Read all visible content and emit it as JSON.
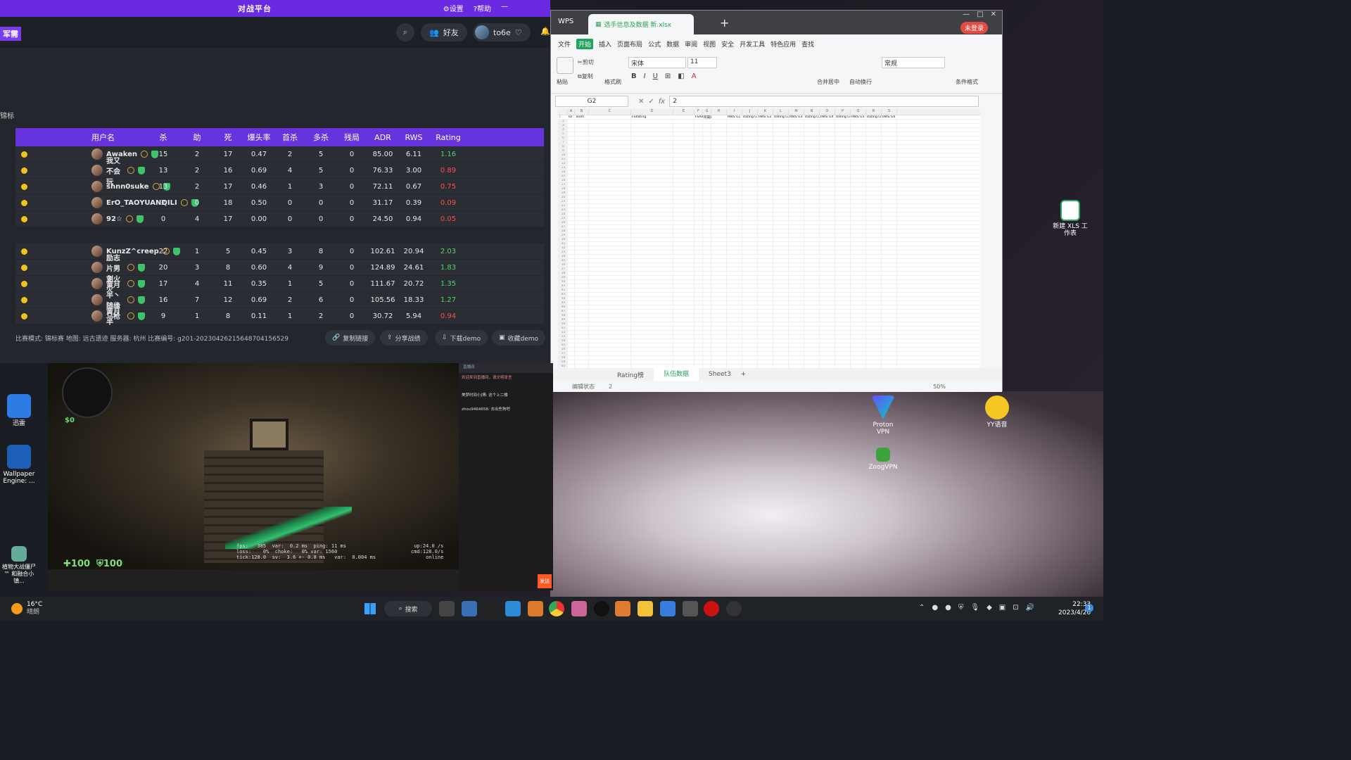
{
  "client": {
    "brand": "对战平台",
    "settings": "设置",
    "help": "帮助",
    "mode_tag": "军需",
    "friends": "好友",
    "username": "to6e",
    "left_label": "锦标"
  },
  "scoreboard": {
    "headers": [
      "用户名",
      "杀",
      "助",
      "死",
      "爆头率",
      "首杀",
      "多杀",
      "残局",
      "ADR",
      "RWS",
      "Rating"
    ],
    "team1": [
      {
        "name": "Awaken",
        "k": "15",
        "a": "2",
        "d": "17",
        "hs": "0.47",
        "fk": "2",
        "mk": "5",
        "cl": "0",
        "adr": "85.00",
        "rws": "6.11",
        "rating": "1.16"
      },
      {
        "name": "我又不会玩",
        "k": "13",
        "a": "2",
        "d": "16",
        "hs": "0.69",
        "fk": "4",
        "mk": "5",
        "cl": "0",
        "adr": "76.33",
        "rws": "3.00",
        "rating": "0.89"
      },
      {
        "name": "shnn0suke",
        "k": "13",
        "a": "2",
        "d": "17",
        "hs": "0.46",
        "fk": "1",
        "mk": "3",
        "cl": "0",
        "adr": "72.11",
        "rws": "0.67",
        "rating": "0.75"
      },
      {
        "name": "ErO_TAOYUANQILI",
        "k": "2",
        "a": "0",
        "d": "18",
        "hs": "0.50",
        "fk": "0",
        "mk": "0",
        "cl": "0",
        "adr": "31.17",
        "rws": "0.39",
        "rating": "0.09"
      },
      {
        "name": "92☆",
        "k": "0",
        "a": "4",
        "d": "17",
        "hs": "0.00",
        "fk": "0",
        "mk": "0",
        "cl": "0",
        "adr": "24.50",
        "rws": "0.94",
        "rating": "0.05"
      }
    ],
    "team2": [
      {
        "name": "KunzZ^creep",
        "k": "22",
        "a": "1",
        "d": "5",
        "hs": "0.45",
        "fk": "3",
        "mk": "8",
        "cl": "0",
        "adr": "102.61",
        "rws": "20.94",
        "rating": "2.03"
      },
      {
        "name": "励志片男主",
        "k": "20",
        "a": "3",
        "d": "8",
        "hs": "0.60",
        "fk": "4",
        "mk": "9",
        "cl": "0",
        "adr": "124.89",
        "rws": "24.61",
        "rating": "1.83"
      },
      {
        "name": "刘火火",
        "k": "17",
        "a": "4",
        "d": "11",
        "hs": "0.35",
        "fk": "1",
        "mk": "5",
        "cl": "0",
        "adr": "111.67",
        "rws": "20.72",
        "rating": "1.35"
      },
      {
        "name": "黄月半丶随缘马枪",
        "k": "16",
        "a": "7",
        "d": "12",
        "hs": "0.69",
        "fk": "2",
        "mk": "6",
        "cl": "0",
        "adr": "105.56",
        "rws": "18.33",
        "rating": "1.27"
      },
      {
        "name": "黄月半",
        "k": "9",
        "a": "1",
        "d": "8",
        "hs": "0.11",
        "fk": "1",
        "mk": "2",
        "cl": "0",
        "adr": "30.72",
        "rws": "5.94",
        "rating": "0.94"
      }
    ],
    "footer": "比赛模式: 锦标赛 地图: 远古遗迹 服务器: 杭州 比赛编号: g201-20230426215648704156529",
    "actions": [
      "复制链接",
      "分享战绩",
      "下载demo",
      "收藏demo"
    ]
  },
  "wps": {
    "app": "WPS",
    "file_tab": "选手信息及数据 新.xlsx",
    "login": "未登录",
    "menu": [
      "文件",
      "开始",
      "插入",
      "页面布局",
      "公式",
      "数据",
      "审阅",
      "视图",
      "安全",
      "开发工具",
      "特色应用",
      "查找"
    ],
    "ribbon": {
      "cut": "剪切",
      "copy": "复制",
      "paste": "粘贴",
      "format_painter": "格式刷",
      "font": "宋体",
      "size": "11",
      "wrap": "自动换行",
      "merge": "合并居中",
      "number_format": "常规",
      "cond_format": "条件格式"
    },
    "cell_ref": "G2",
    "formula_value": "2",
    "col_letters": [
      "A",
      "B",
      "C",
      "D",
      "E",
      "F",
      "G",
      "H",
      "I",
      "J",
      "K",
      "L",
      "M",
      "N",
      "O",
      "P",
      "Q",
      "R",
      "S"
    ],
    "header_row": [
      "ID",
      "Team",
      "",
      "FSRating",
      "",
      "FSRWS",
      "所属组",
      "",
      "RWS G1",
      "Rating G1",
      "RWS G2",
      "Rating G2",
      "RWS G3",
      "Rating G3",
      "RWS G4",
      "Rating G4",
      "RWS G5",
      "Rating G5",
      "RWS G6"
    ],
    "sheet_tabs": [
      "Rating榜",
      "队伍数据",
      "Sheet3"
    ],
    "status_mode": "编辑状态",
    "status_value": "2",
    "zoom": "50%"
  },
  "game_hud": {
    "money": "$0",
    "hp": "100",
    "armor": "100",
    "net_left": "fps:   385  var:  0.2 ms  ping: 11 ms\nloss:    0%  choke:   0% var: 1560\ntick:128.0  sv:  3.6 +- 0.8 ms   var:  0.004 ms",
    "net_right": "up:24.0 /s\ncmd:128.0/s\nonline"
  },
  "chat": {
    "title": "直播间",
    "lines": [
      "欢迎来到直播间，请文明发言",
      "美梦时间小J博: 这个上二楼",
      "zhou9464658: 去出些狗吧"
    ],
    "send": "发送"
  },
  "desktop": {
    "icons_left": [
      "迅雷",
      "Wallpaper Engine: ...",
      "植物大战僵尸™ 和融合小镇..."
    ],
    "icons_right": [
      "新建 XLS 工作表",
      "Proton VPN",
      "YY语音",
      "ZoogVPN"
    ]
  },
  "taskbar": {
    "weather_temp": "16°C",
    "weather_desc": "晴朗",
    "search": "搜索",
    "time": "22:33",
    "date": "2023/4/26",
    "badge": "1"
  }
}
